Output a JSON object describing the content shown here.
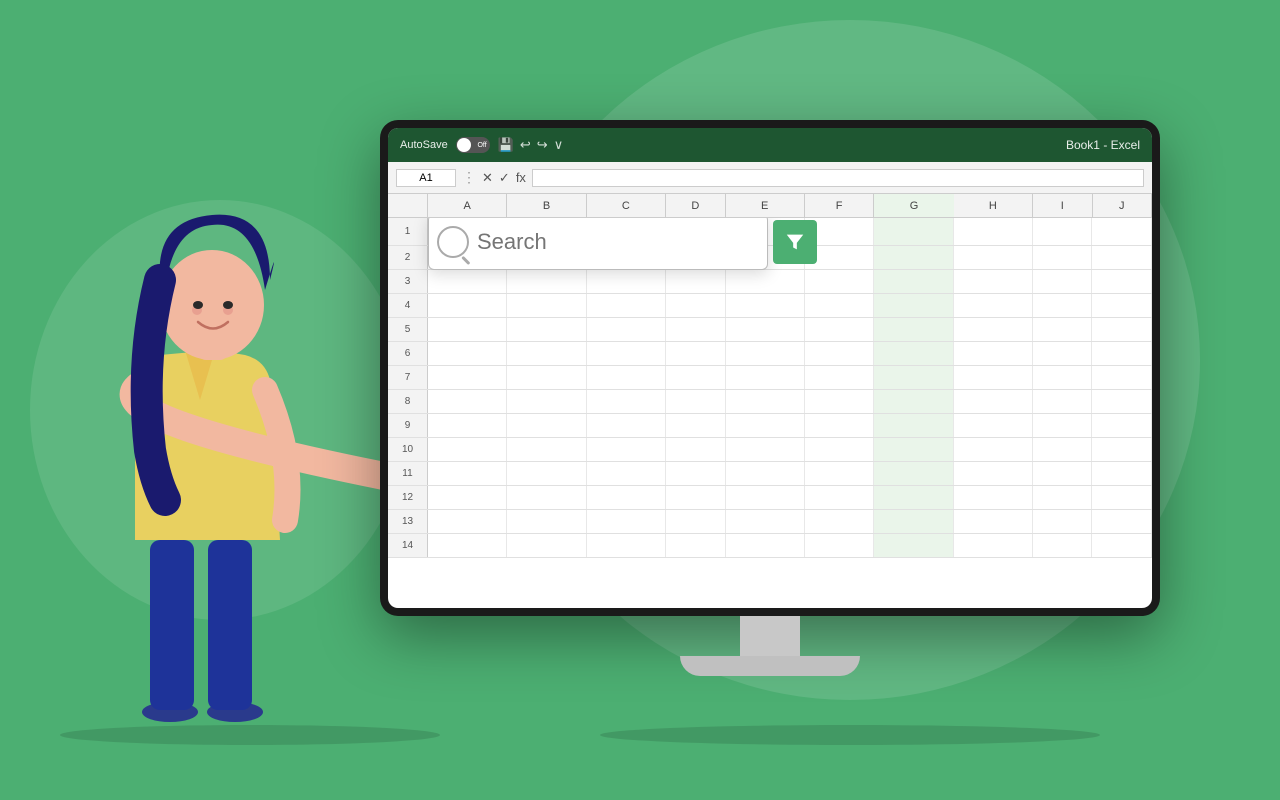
{
  "background": {
    "color": "#4caf72"
  },
  "excel": {
    "titlebar": {
      "autosave_label": "AutoSave",
      "toggle_state": "Off",
      "title": "Book1  -  Excel"
    },
    "formula_bar": {
      "cell_ref": "A1",
      "formula_text": ""
    },
    "columns": [
      "A",
      "B",
      "C",
      "D",
      "E",
      "F",
      "G",
      "H",
      "I",
      "J"
    ],
    "rows": [
      1,
      2,
      3,
      4,
      5,
      6,
      7,
      8,
      9,
      10,
      11,
      12,
      13,
      14
    ]
  },
  "search_box": {
    "placeholder": "Search",
    "search_icon": "search-icon",
    "filter_icon": "filter-icon"
  }
}
